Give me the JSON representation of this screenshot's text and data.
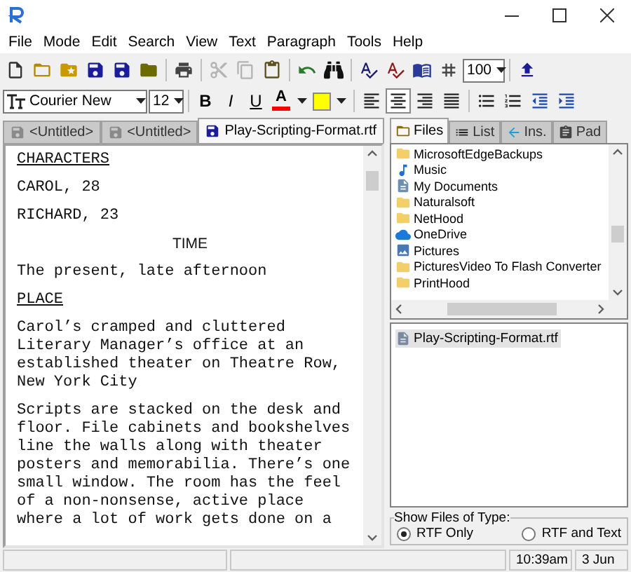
{
  "menu": [
    "File",
    "Mode",
    "Edit",
    "Search",
    "View",
    "Text",
    "Paragraph",
    "Tools",
    "Help"
  ],
  "toolbar": {
    "buttons": [
      {
        "kind": "new",
        "disabled": false
      },
      {
        "kind": "open",
        "disabled": false
      },
      {
        "kind": "favorites",
        "disabled": false
      },
      {
        "kind": "save",
        "disabled": false
      },
      {
        "kind": "save_all",
        "disabled": false
      },
      {
        "kind": "folder",
        "disabled": false
      },
      {
        "kind": "separator"
      },
      {
        "kind": "print",
        "disabled": false
      },
      {
        "kind": "separator"
      },
      {
        "kind": "cut",
        "disabled": true
      },
      {
        "kind": "copy",
        "disabled": true
      },
      {
        "kind": "paste",
        "disabled": false
      },
      {
        "kind": "separator"
      },
      {
        "kind": "undo",
        "disabled": false
      },
      {
        "kind": "find",
        "disabled": false
      },
      {
        "kind": "separator"
      },
      {
        "kind": "spellcheck",
        "disabled": false
      },
      {
        "kind": "spellcheck_live",
        "disabled": false
      },
      {
        "kind": "dictionary",
        "disabled": false
      },
      {
        "kind": "page_number",
        "disabled": false
      },
      {
        "kind": "zoom",
        "value": "100"
      },
      {
        "kind": "separator"
      },
      {
        "kind": "save_up",
        "disabled": false
      }
    ]
  },
  "format": {
    "font": "Courier New",
    "size": "12",
    "styles": [
      {
        "kind": "bold",
        "label": "B",
        "on": false
      },
      {
        "kind": "italic",
        "label": "I",
        "on": false
      },
      {
        "kind": "underline",
        "label": "U",
        "on": false
      }
    ],
    "font_color": {
      "label": "A",
      "color": "#ff0000"
    },
    "highlight": {
      "color": "#ffff00"
    },
    "alignment": [
      {
        "kind": "left",
        "selected": false
      },
      {
        "kind": "center",
        "selected": true
      },
      {
        "kind": "right",
        "selected": false
      },
      {
        "kind": "justify",
        "selected": false
      }
    ]
  },
  "document_tabs": [
    {
      "label": "<Untitled>",
      "selected": false
    },
    {
      "label": "<Untitled>",
      "selected": false
    },
    {
      "label": "Play-Scripting-Format.rtf",
      "selected": true
    }
  ],
  "document": [
    {
      "kind": "heading",
      "lines": [
        "CHARACTERS"
      ]
    },
    {
      "kind": "plain",
      "lines": [
        "CAROL, 28"
      ]
    },
    {
      "kind": "plain",
      "lines": [
        "RICHARD, 23"
      ]
    },
    {
      "kind": "centered",
      "lines": [
        "TIME"
      ]
    },
    {
      "kind": "plain",
      "lines": [
        "The present, late afternoon"
      ]
    },
    {
      "kind": "heading",
      "lines": [
        "PLACE"
      ]
    },
    {
      "kind": "plain",
      "lines": [
        "Carol’s cramped and cluttered",
        "Literary Manager’s office at an",
        "established theater on Theatre Row,",
        "New York City"
      ]
    },
    {
      "kind": "plain",
      "lines": [
        "Scripts are stacked on the desk and",
        "floor. File cabinets and bookshelves",
        "line the walls along with theater",
        "posters and memorabilia. There’s one",
        "small window. The room has the feel",
        "of a non-nonsense, active place",
        "where a lot of work gets done on a"
      ]
    }
  ],
  "side_tabs": [
    {
      "kind": "files",
      "label": "Files",
      "selected": true
    },
    {
      "kind": "list",
      "label": "List",
      "selected": false
    },
    {
      "kind": "insert",
      "label": "Ins.",
      "selected": false
    },
    {
      "kind": "pad",
      "label": "Pad",
      "selected": false
    }
  ],
  "folder_tree": [
    {
      "kind": "folder",
      "label": "MicrosoftEdgeBackups"
    },
    {
      "kind": "music",
      "label": "Music"
    },
    {
      "kind": "documents",
      "label": "My Documents"
    },
    {
      "kind": "folder",
      "label": "Naturalsoft"
    },
    {
      "kind": "folder",
      "label": "NetHood"
    },
    {
      "kind": "cloud",
      "label": "OneDrive"
    },
    {
      "kind": "pictures",
      "label": "Pictures"
    },
    {
      "kind": "folder",
      "label": "PicturesVideo To Flash Converter"
    },
    {
      "kind": "folder",
      "label": "PrintHood"
    }
  ],
  "files": [
    {
      "name": "Play-Scripting-Format.rtf",
      "selected": true
    }
  ],
  "file_type_filter": {
    "title": "Show Files of Type:",
    "options": [
      {
        "label": "RTF Only",
        "selected": true
      },
      {
        "label": "RTF and Text",
        "selected": false
      }
    ]
  },
  "status_bar": {
    "time": "10:39am",
    "date": "3 Jun"
  }
}
